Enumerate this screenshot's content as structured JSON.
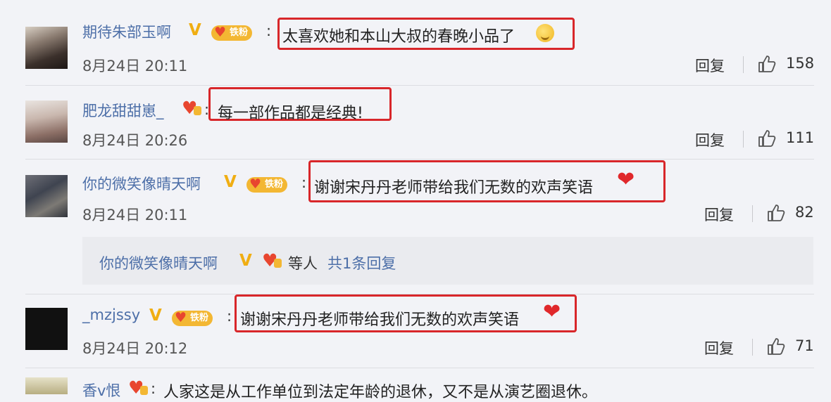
{
  "comments": [
    {
      "username": "期待朱部玉啊",
      "verified": "V",
      "fan_badge": "铁粉",
      "text": "太喜欢她和本山大叔的春晚小品了",
      "date": "8月24日 20:11",
      "reply_label": "回复",
      "likes": "158"
    },
    {
      "username": "肥龙甜甜崽_",
      "text": "每一部作品都是经典!",
      "date": "8月24日 20:26",
      "reply_label": "回复",
      "likes": "111"
    },
    {
      "username": "你的微笑像晴天啊",
      "verified": "V",
      "fan_badge": "铁粉",
      "text": "谢谢宋丹丹老师带给我们无数的欢声笑语",
      "date": "8月24日 20:11",
      "reply_label": "回复",
      "likes": "82"
    },
    {
      "username": "_mzjssy",
      "verified": "V",
      "fan_badge": "铁粉",
      "text": "谢谢宋丹丹老师带给我们无数的欢声笑语",
      "date": "8月24日 20:12",
      "reply_label": "回复",
      "likes": "71"
    },
    {
      "username": "香v恨",
      "text": "人家这是从工作单位到法定年龄的退休，又不是从演艺圈退休。"
    }
  ],
  "reply_summary": {
    "username": "你的微笑像晴天啊",
    "verified": "V",
    "suffix": "等人",
    "link": "共1条回复"
  },
  "colors": {
    "username": "#4d6fa8",
    "highlight_box": "#d8262a",
    "vip_gold": "#f0ae13",
    "heart": "#e0282b"
  },
  "icons": [
    "fan-badge-icon",
    "verified-v-icon",
    "thumb-up-icon",
    "heart-icon",
    "crying-emoji-icon"
  ]
}
